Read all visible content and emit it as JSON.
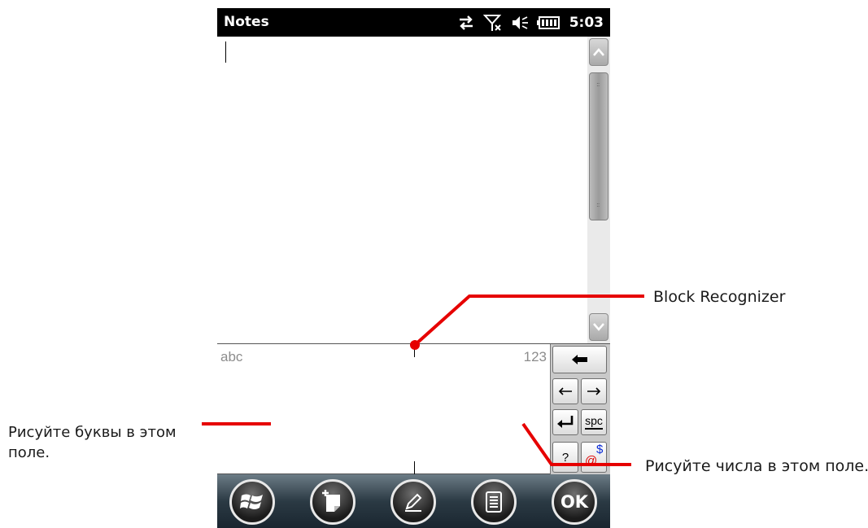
{
  "statusbar": {
    "app_title": "Notes",
    "time": "5:03",
    "icons": [
      "data-sync-icon",
      "no-signal-icon",
      "speaker-muted-icon",
      "battery-icon"
    ]
  },
  "input_panel": {
    "alpha_hint": "abc",
    "numeric_hint": "123",
    "keys": {
      "space": "spc",
      "symbol": "?",
      "at": "@",
      "dollar": "$"
    }
  },
  "toolbar": {
    "ok_label": "OK",
    "buttons": [
      "windows-start-icon",
      "new-note-icon",
      "pen-icon",
      "menu-icon"
    ]
  },
  "annotations": {
    "block_recognizer": "Block Recognizer",
    "letters_area": "Рисуйте буквы в этом поле.",
    "numbers_area": "Рисуйте числа в этом поле."
  },
  "colors": {
    "callout_red": "#e60000",
    "toolbar_dark": "#1a2630",
    "statusbar": "#000000"
  }
}
